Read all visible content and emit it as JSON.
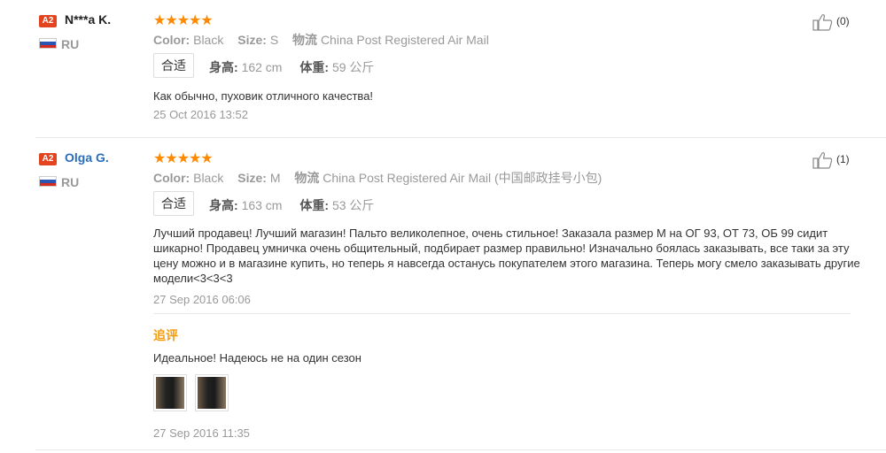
{
  "reviews": [
    {
      "badge": "A2",
      "name": "N***a K.",
      "name_color": "#222222",
      "country": "RU",
      "stars": "★★★★★",
      "color_label": "Color:",
      "color_value": "Black",
      "size_label": "Size:",
      "size_value": "S",
      "ship_label": "物流",
      "ship_value": "China Post Registered Air Mail",
      "fit": "合适",
      "height_label": "身高:",
      "height_value": "162 cm",
      "weight_label": "体重:",
      "weight_value": "59 公斤",
      "text": "Как обычно, пуховик отличного качества!",
      "date": "25 Oct 2016 13:52",
      "likes": "(0)"
    },
    {
      "badge": "A2",
      "name": "Olga G.",
      "name_color": "#2a6ebb",
      "country": "RU",
      "stars": "★★★★★",
      "color_label": "Color:",
      "color_value": "Black",
      "size_label": "Size:",
      "size_value": "M",
      "ship_label": "物流",
      "ship_value": "China Post Registered Air Mail (中国邮政挂号小包)",
      "fit": "合适",
      "height_label": "身高:",
      "height_value": "163 cm",
      "weight_label": "体重:",
      "weight_value": "53 公斤",
      "text": "Лучший продавец! Лучший магазин! Пальто великолепное, очень стильное! Заказала размер М на ОГ 93, ОТ 73, ОБ 99 сидит шикарно! Продавец умничка очень общительный, подбирает размер правильно! Изначально боялась заказывать, все таки за эту цену можно и в магазине купить, но теперь я навсегда останусь покупателем этого магазина. Теперь могу смело заказывать другие модели<3<3<3",
      "date": "27 Sep 2016 06:06",
      "likes": "(1)",
      "followup": {
        "label": "追评",
        "text": "Идеальное! Надеюсь не на один сезон",
        "date": "27 Sep 2016 11:35"
      }
    }
  ],
  "colors": {
    "star": "#ff8a00",
    "badge": "#e3431f",
    "followup_label": "#f39c12"
  },
  "icons": {
    "like": "thumbs-up-icon",
    "flag": "russia-flag-icon"
  }
}
